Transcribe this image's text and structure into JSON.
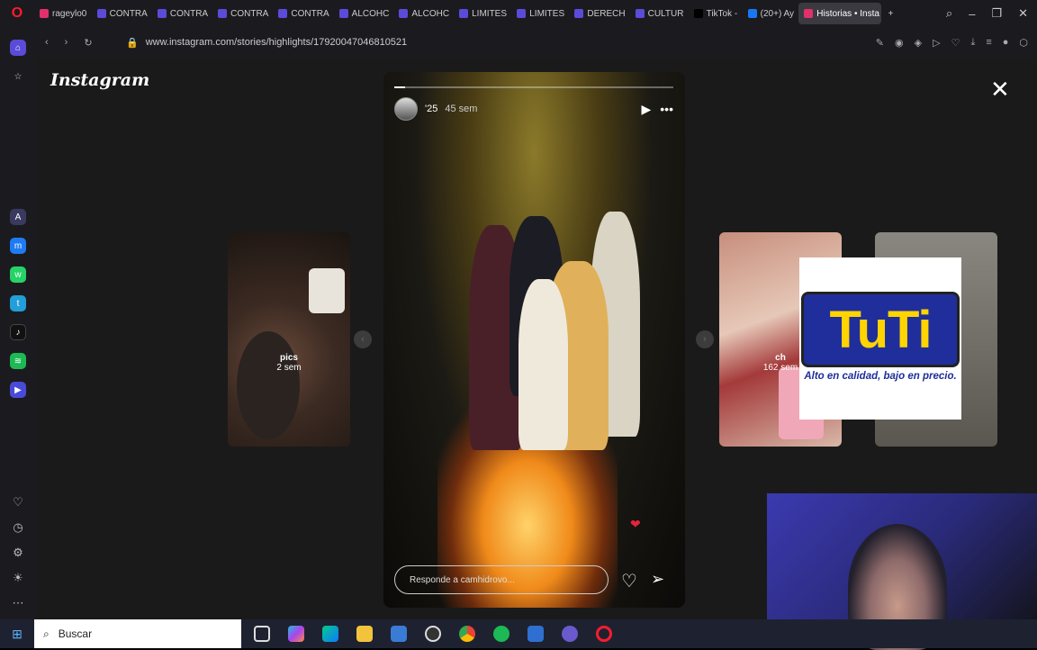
{
  "browser": {
    "tabs": [
      {
        "label": "rageylo0",
        "color": "#e1306c"
      },
      {
        "label": "CONTRA",
        "color": "#5b4bd8"
      },
      {
        "label": "CONTRA",
        "color": "#5b4bd8"
      },
      {
        "label": "CONTRA",
        "color": "#5b4bd8"
      },
      {
        "label": "CONTRA",
        "color": "#5b4bd8"
      },
      {
        "label": "ALCOHC",
        "color": "#5b4bd8"
      },
      {
        "label": "ALCOHC",
        "color": "#5b4bd8"
      },
      {
        "label": "LIMITES",
        "color": "#5b4bd8"
      },
      {
        "label": "LIMITES",
        "color": "#5b4bd8"
      },
      {
        "label": "DERECH",
        "color": "#5b4bd8"
      },
      {
        "label": "CULTUR",
        "color": "#5b4bd8"
      },
      {
        "label": "TikTok -",
        "color": "#000000"
      },
      {
        "label": "(20+) Ay",
        "color": "#1877f2"
      },
      {
        "label": "Historias • Insta",
        "color": "#e1306c",
        "active": true
      }
    ],
    "url": "www.instagram.com/stories/highlights/17920047046810521"
  },
  "page": {
    "logo": "Instagram",
    "close": "✕",
    "story": {
      "username": "'25",
      "time": "45 sem",
      "reply_placeholder": "Responde a camhidrovo..."
    },
    "prev_thumb": {
      "title": "pics",
      "time": "2 sem"
    },
    "next_thumb": {
      "title": "ch",
      "time": "162 sem"
    }
  },
  "overlay": {
    "brand": "TuTi",
    "slogan": "Alto en calidad, bajo en precio."
  },
  "taskbar": {
    "search_label": "Buscar"
  }
}
